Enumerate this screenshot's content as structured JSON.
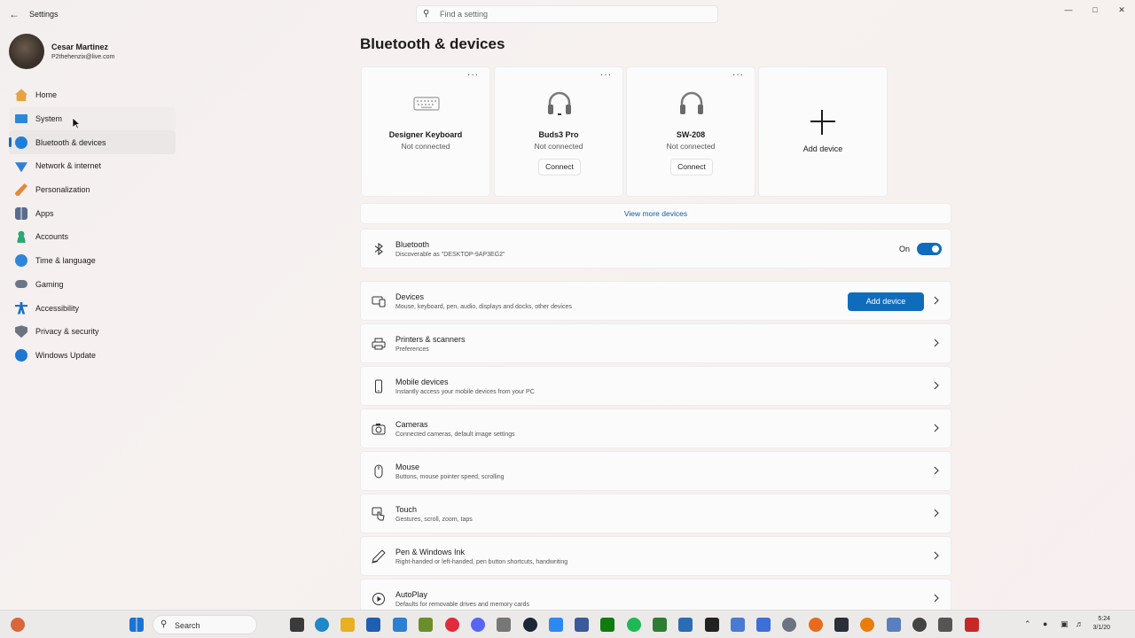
{
  "window": {
    "title": "Settings",
    "search_placeholder": "Find a setting"
  },
  "profile": {
    "name": "Cesar Martinez",
    "email": "P2thehenzix@live.com"
  },
  "nav": [
    {
      "label": "Home",
      "icon": "home-icon",
      "color": "#e8a33d"
    },
    {
      "label": "System",
      "icon": "system-icon",
      "color": "#2b88d8"
    },
    {
      "label": "Bluetooth & devices",
      "icon": "bluetooth-icon",
      "color": "#1f7fd6",
      "selected": true
    },
    {
      "label": "Network & internet",
      "icon": "network-icon",
      "color": "#2f7fd6"
    },
    {
      "label": "Personalization",
      "icon": "brush-icon",
      "color": "#e08a3a"
    },
    {
      "label": "Apps",
      "icon": "apps-icon",
      "color": "#5a6b8c"
    },
    {
      "label": "Accounts",
      "icon": "accounts-icon",
      "color": "#2aa876"
    },
    {
      "label": "Time & language",
      "icon": "time-language-icon",
      "color": "#2f86d8"
    },
    {
      "label": "Gaming",
      "icon": "gaming-icon",
      "color": "#6b7686"
    },
    {
      "label": "Accessibility",
      "icon": "accessibility-icon",
      "color": "#1b6fc9"
    },
    {
      "label": "Privacy & security",
      "icon": "shield-icon",
      "color": "#6d7480"
    },
    {
      "label": "Windows Update",
      "icon": "update-icon",
      "color": "#1d78d4"
    }
  ],
  "main": {
    "title": "Bluetooth & devices",
    "device_cards": [
      {
        "name": "Designer Keyboard",
        "status": "Not connected",
        "icon": "keyboard-icon",
        "connect_label": null
      },
      {
        "name": "Buds3 Pro",
        "status": "Not connected",
        "icon": "headphones-icon",
        "connect_label": "Connect"
      },
      {
        "name": "SW-208",
        "status": "Not connected",
        "icon": "headphones-icon",
        "connect_label": "Connect"
      }
    ],
    "more_glyph": "···",
    "add_card_label": "Add device",
    "view_more": "View more devices",
    "bluetooth": {
      "title": "Bluetooth",
      "desc": "Discoverable as \"DESKTOP-9AP3EG2\"",
      "toggle_label": "On",
      "on": true
    },
    "rows": [
      {
        "title": "Devices",
        "desc": "Mouse, keyboard, pen, audio, displays and docks, other devices",
        "icon": "devices-icon",
        "button": "Add device"
      },
      {
        "title": "Printers & scanners",
        "desc": "Preferences",
        "icon": "printer-icon"
      },
      {
        "title": "Mobile devices",
        "desc": "Instantly access your mobile devices from your PC",
        "icon": "phone-icon"
      },
      {
        "title": "Cameras",
        "desc": "Connected cameras, default image settings",
        "icon": "camera-icon"
      },
      {
        "title": "Mouse",
        "desc": "Buttons, mouse pointer speed, scrolling",
        "icon": "mouse-icon"
      },
      {
        "title": "Touch",
        "desc": "Gestures, scroll, zoom, taps",
        "icon": "touch-icon"
      },
      {
        "title": "Pen & Windows Ink",
        "desc": "Right-handed or left-handed, pen button shortcuts, handwriting",
        "icon": "pen-icon"
      },
      {
        "title": "AutoPlay",
        "desc": "Defaults for removable drives and memory cards",
        "icon": "autoplay-icon"
      }
    ]
  },
  "taskbar": {
    "search_label": "Search",
    "clock_time": "5:24",
    "clock_date": "3/1/20"
  },
  "colors": {
    "accent": "#0f6cbd",
    "link": "#0f5ea8"
  }
}
